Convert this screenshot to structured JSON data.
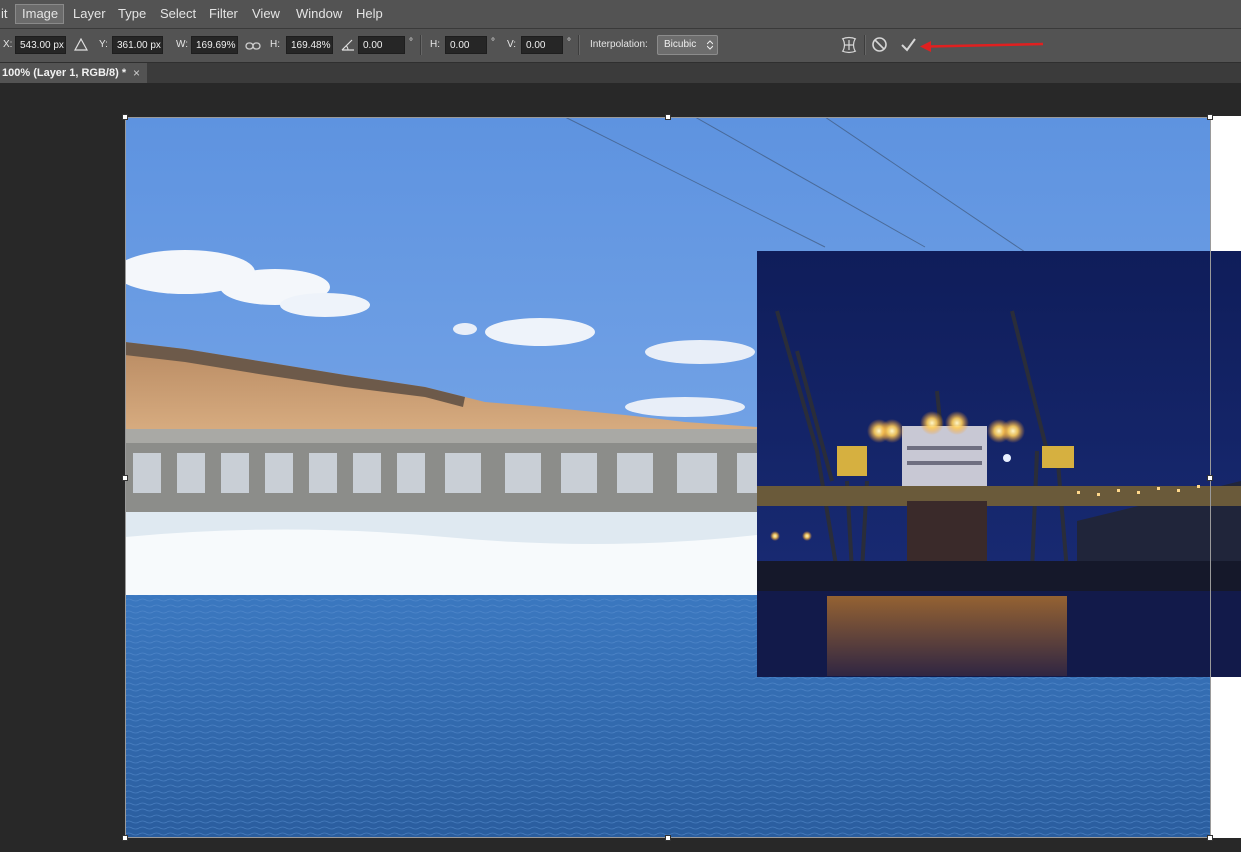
{
  "menu": {
    "items": [
      "it",
      "Image",
      "Layer",
      "Type",
      "Select",
      "Filter",
      "View",
      "Window",
      "Help"
    ],
    "active": "Image"
  },
  "options": {
    "x_label": "X:",
    "x_value": "543.00 px",
    "y_label": "Y:",
    "y_value": "361.00 px",
    "w_label": "W:",
    "w_value": "169.69%",
    "h_label": "H:",
    "h_value": "169.48%",
    "angle_value": "0.00",
    "skew_h_label": "H:",
    "skew_h_value": "0.00",
    "skew_v_label": "V:",
    "skew_v_value": "0.00",
    "degree_symbol": "°",
    "interpolation_label": "Interpolation:",
    "interpolation_value": "Bicubic"
  },
  "document": {
    "tab_title": "100%  (Layer 1, RGB/8) *",
    "close_glyph": "×"
  },
  "icons": {
    "warp": "warp-icon",
    "cancel": "cancel-transform-icon",
    "commit": "commit-checkmark-icon",
    "annotation": "red-arrow-annotation"
  },
  "colors": {
    "menu_bg": "#535353",
    "panel_bg": "#282828",
    "annotation_arrow": "#e02020"
  }
}
